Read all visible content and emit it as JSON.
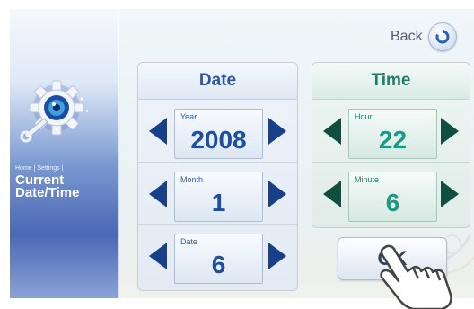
{
  "sidebar": {
    "breadcrumb": "Home | Settings |",
    "title_line1": "Current",
    "title_line2": "Date/Time"
  },
  "header": {
    "back_label": "Back"
  },
  "date_panel": {
    "title": "Date",
    "fields": [
      {
        "label": "Year",
        "value": "2008"
      },
      {
        "label": "Month",
        "value": "1"
      },
      {
        "label": "Date",
        "value": "6"
      }
    ]
  },
  "time_panel": {
    "title": "Time",
    "fields": [
      {
        "label": "Hour",
        "value": "22"
      },
      {
        "label": "Minute",
        "value": "6"
      }
    ]
  },
  "ok_label": "OK",
  "icons": {
    "logo": "settings-gear-wrench-icon",
    "back": "refresh-back-icon",
    "cursor": "pointing-hand-icon",
    "decrement": "left-arrow-icon",
    "increment": "right-arrow-icon"
  },
  "colors": {
    "date_accent": "#2c55a6",
    "time_accent": "#1f7f6c",
    "arrow_date": "#173f8a",
    "arrow_time": "#0e4f3f"
  }
}
